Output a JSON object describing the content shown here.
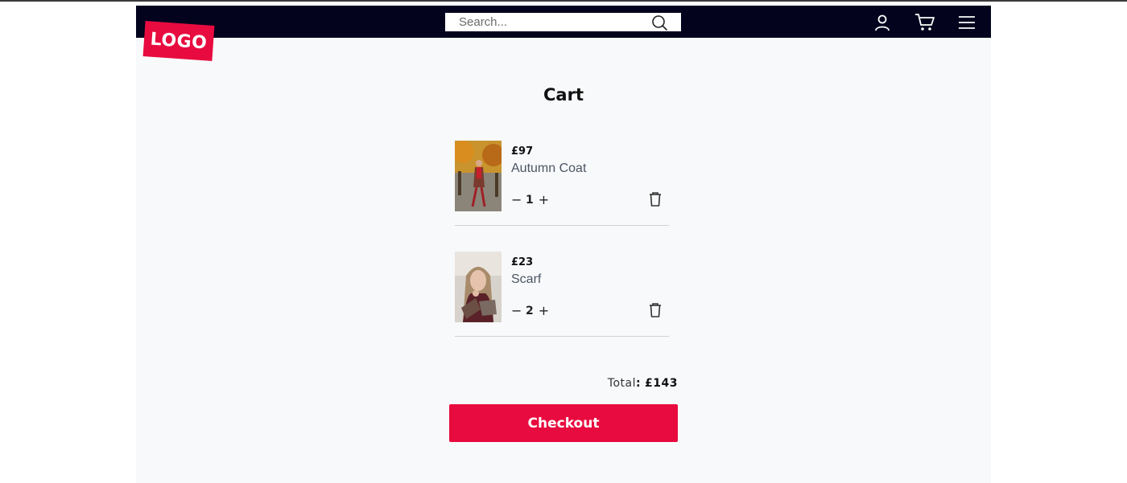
{
  "brand": {
    "logo_text": "LOGO",
    "accent": "#e80b3f",
    "nav_bg": "#03031e"
  },
  "search": {
    "placeholder": "Search...",
    "icon": "search-icon"
  },
  "nav_icons": [
    "user-icon",
    "cart-icon",
    "hamburger-menu-icon"
  ],
  "cart": {
    "title": "Cart",
    "items": [
      {
        "price": "£97",
        "name": "Autumn Coat",
        "quantity": "1",
        "decrement": "−",
        "increment": "+"
      },
      {
        "price": "£23",
        "name": "Scarf",
        "quantity": "2",
        "decrement": "−",
        "increment": "+"
      }
    ],
    "total_label": "Total",
    "total_sep": ":",
    "total_value": "£143",
    "checkout_label": "Checkout"
  }
}
